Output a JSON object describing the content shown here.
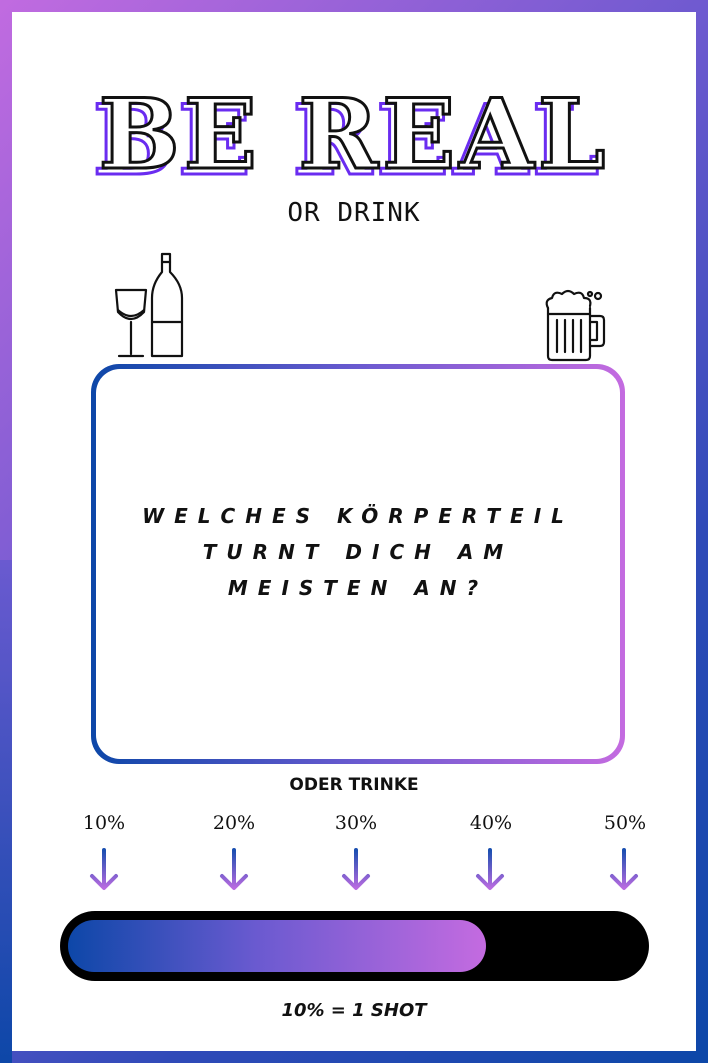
{
  "title": "BE REAL",
  "subtitle": "OR DRINK",
  "question": "Welches Körperteil turnt dich am meisten an?",
  "oder_label": "ODER TRINKE",
  "percent_labels": [
    "10%",
    "20%",
    "30%",
    "40%",
    "50%"
  ],
  "progress": {
    "fraction": 0.73
  },
  "footer": "10% = 1 SHOT",
  "icons": {
    "left": "wine-glass-and-bottle-icon",
    "right": "beer-mug-icon",
    "pointer": "down-arrow-icon"
  },
  "colors": {
    "accent_blue": "#0d47a8",
    "accent_violet": "#6a5ad0",
    "accent_pink": "#c46be0",
    "title_shadow": "#6a2cf0"
  }
}
